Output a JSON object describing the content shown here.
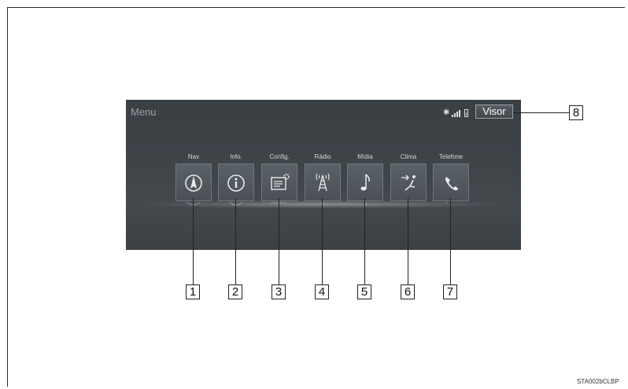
{
  "screen": {
    "title": "Menu",
    "visor_label": "Visor",
    "status_icons": [
      "bluetooth-icon",
      "signal-bars-icon",
      "battery-icon"
    ]
  },
  "menu_items": [
    {
      "label": "Nav",
      "icon": "compass-icon"
    },
    {
      "label": "Info.",
      "icon": "info-icon"
    },
    {
      "label": "Config.",
      "icon": "settings-icon"
    },
    {
      "label": "Rádio",
      "icon": "radio-tower-icon"
    },
    {
      "label": "Mídia",
      "icon": "music-note-icon"
    },
    {
      "label": "Clima",
      "icon": "climate-seat-icon"
    },
    {
      "label": "Telefone",
      "icon": "phone-icon"
    }
  ],
  "callouts": [
    "1",
    "2",
    "3",
    "4",
    "5",
    "6",
    "7",
    "8"
  ],
  "image_code": "STA002bCLBP",
  "colors": {
    "screen_bg": "#3f4449",
    "label_text": "#d2d6d8"
  }
}
